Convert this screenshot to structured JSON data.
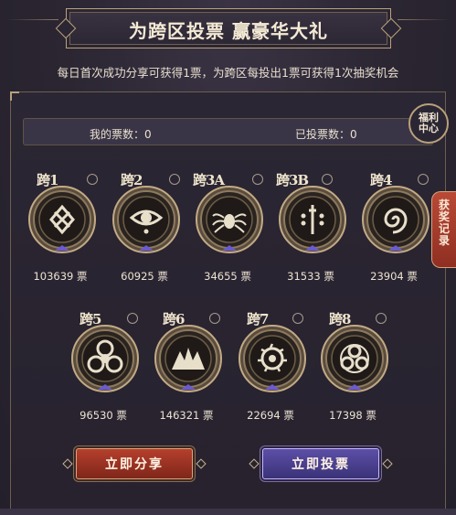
{
  "title": "为跨区投票 赢豪华大礼",
  "subtitle": "每日首次成功分享可获得1票，为跨区每投出1票可获得1次抽奖机会",
  "stats": {
    "my_votes": "我的票数：0",
    "voted_count": "已投票数：0"
  },
  "welfare_label": "福利中心",
  "record_label": [
    "获",
    "奖",
    "记",
    "录"
  ],
  "servers": [
    {
      "name": "跨1",
      "votes": "103639 票",
      "icon": "diamond-knot-icon"
    },
    {
      "name": "跨2",
      "votes": "60925 票",
      "icon": "eye-icon"
    },
    {
      "name": "跨3A",
      "votes": "34655 票",
      "icon": "spider-icon"
    },
    {
      "name": "跨3B",
      "votes": "31533 票",
      "icon": "sword-dots-icon"
    },
    {
      "name": "跨4",
      "votes": "23904 票",
      "icon": "spiral-icon"
    },
    {
      "name": "跨5",
      "votes": "96530 票",
      "icon": "biohazard-icon"
    },
    {
      "name": "跨6",
      "votes": "146321 票",
      "icon": "mountains-icon"
    },
    {
      "name": "跨7",
      "votes": "22694 票",
      "icon": "flaming-eye-icon"
    },
    {
      "name": "跨8",
      "votes": "17398 票",
      "icon": "triple-circles-icon"
    }
  ],
  "buttons": {
    "share": "立即分享",
    "vote": "立即投票"
  },
  "colors": {
    "background": "#2c2734",
    "share_button": "#b53f2d",
    "vote_button": "#5b4fa6",
    "accent_gold": "#b9a17a"
  }
}
